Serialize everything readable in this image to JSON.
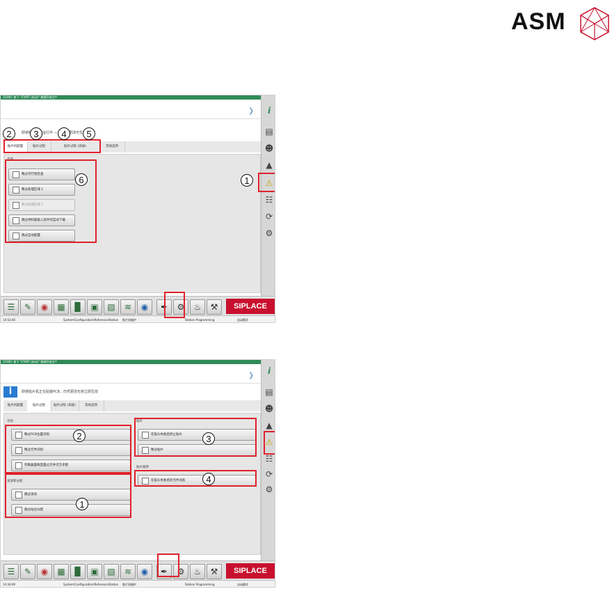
{
  "brand": {
    "name": "ASM"
  },
  "colors": {
    "accent_red": "#e0202a",
    "siplace_red": "#c8102e",
    "title_green": "#2e8b57"
  },
  "shot1": {
    "title": "31900: 按下 \"START (启动)\" 按键开始生产",
    "info_text": "即使贴片机在运行中 — 也应当更改可生效",
    "tabs": [
      "贴片机配置",
      "贴片过程",
      "贴片过程 (高级)",
      "其他选项"
    ],
    "group_title": "选项",
    "options": [
      {
        "label": "略过可行性检查",
        "enabled": true
      },
      {
        "label": "略过处理区域 1",
        "enabled": true
      },
      {
        "label": "略过处理区域 2",
        "enabled": false
      },
      {
        "label": "跳过供料器嵌入软件的自动下载",
        "enabled": true
      },
      {
        "label": "跳过自动配置",
        "enabled": true
      }
    ],
    "callouts": [
      "1",
      "2",
      "3",
      "4",
      "5",
      "6"
    ],
    "status": {
      "time": "14:53:40",
      "path": "System\\Configuration\\ReferenceStation",
      "station": "贴片机维护",
      "mode_text": "Station Programming",
      "auto": "自动模式"
    }
  },
  "shot2": {
    "title": "31900: 按下 \"START (启动)\" 按键开始生产",
    "info_text": "即使贴片机正在贴装PCB，仍然更改也将立即生效",
    "tabs": [
      "贴片机配置",
      "贴片过程",
      "贴片过程 (高级)",
      "其他选项"
    ],
    "groups": {
      "identify": {
        "title": "识别",
        "options": [
          "略过PCB位置识别",
          "略过元件识别",
          "列库器面每室面过元件识方步骤"
        ]
      },
      "rollout": {
        "title": "滚滚和分配",
        "options": [
          "跳过滚动",
          "跳过站台分配"
        ]
      },
      "placement": {
        "title": "贴片",
        "options": [
          "在吸头失败后停止贴片",
          "略过贴片"
        ]
      },
      "sequence": {
        "title": "贴片顺序",
        "options": [
          "在吸头失败后的元件兆焦"
        ]
      }
    },
    "callouts": [
      "1",
      "2",
      "3",
      "4"
    ],
    "status": {
      "time": "14:34:09",
      "path": "System\\Configuration\\ReferenceStation",
      "station": "贴片机维护",
      "mode_text": "Station Programming",
      "auto": "自动模式"
    }
  },
  "sidebar_icons": [
    "info-icon",
    "station-icon",
    "users-icon",
    "layout-icon",
    "warning-icon",
    "feeder-icon",
    "tape-icon",
    "nozzle-icon"
  ],
  "bottom_icons": [
    "layers-icon",
    "tool-icon",
    "palette-icon",
    "grid-icon",
    "chart-icon",
    "save-icon",
    "book-icon",
    "graph-icon",
    "camera-icon",
    "wrench-icon",
    "gear-icon",
    "oil-icon",
    "spanner-icon"
  ],
  "siplace_label": "SIPLACE"
}
